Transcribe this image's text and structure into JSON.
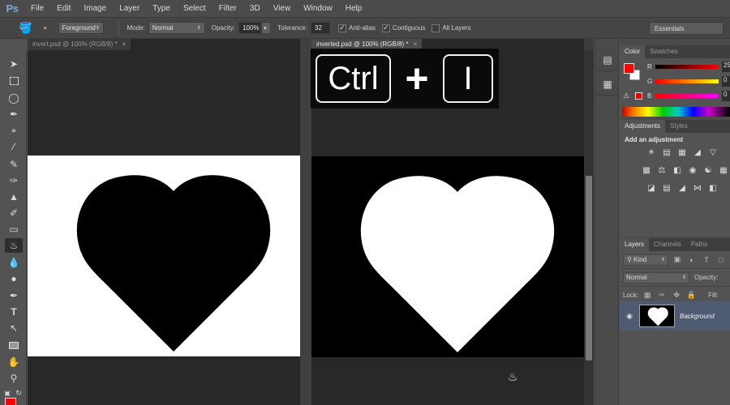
{
  "app": {
    "logo": "Ps",
    "menu": [
      "File",
      "Edit",
      "Image",
      "Layer",
      "Type",
      "Select",
      "Filter",
      "3D",
      "View",
      "Window",
      "Help"
    ]
  },
  "options_bar": {
    "fill_source": "Foreground",
    "mode_label": "Mode:",
    "mode_value": "Normal",
    "opacity_label": "Opacity:",
    "opacity_value": "100%",
    "tolerance_label": "Tolerance:",
    "tolerance_value": "32",
    "anti_alias_label": "Anti-alias",
    "anti_alias_checked": true,
    "contiguous_label": "Contiguous",
    "contiguous_checked": true,
    "all_layers_label": "All Layers",
    "all_layers_checked": false,
    "workspace": "Essentials"
  },
  "toolbox": {
    "tools": [
      "move-tool",
      "marquee-tool",
      "lasso-tool",
      "quick-selection-tool",
      "crop-tool",
      "eyedropper-tool",
      "healing-brush-tool",
      "brush-tool",
      "clone-stamp-tool",
      "history-brush-tool",
      "eraser-tool",
      "paint-bucket-tool",
      "blur-tool",
      "dodge-tool",
      "pen-tool",
      "type-tool",
      "path-selection-tool",
      "rectangle-tool",
      "hand-tool",
      "zoom-tool"
    ],
    "active_tool": "paint-bucket-tool",
    "foreground_color": "#ff0000",
    "background_color": "#ffffff"
  },
  "documents": [
    {
      "tab_label": "invert.psd @ 100% (RGB/8) *",
      "active": false,
      "canvas_bg": "#ffffff",
      "heart_color": "#000000"
    },
    {
      "tab_label": "inverted.psd @ 100% (RGB/8) *",
      "active": true,
      "canvas_bg": "#000000",
      "heart_color": "#ffffff"
    }
  ],
  "shortcut_overlay": {
    "key1": "Ctrl",
    "plus": "+",
    "key2": "I"
  },
  "color_panel": {
    "tabs": [
      "Color",
      "Swatches"
    ],
    "active_tab": "Color",
    "channels": [
      {
        "label": "R",
        "value": "25"
      },
      {
        "label": "G",
        "value": "0"
      },
      {
        "label": "B",
        "value": "0"
      }
    ]
  },
  "adjustments_panel": {
    "tabs": [
      "Adjustments",
      "Styles"
    ],
    "active_tab": "Adjustments",
    "title": "Add an adjustment"
  },
  "layers_panel": {
    "tabs": [
      "Layers",
      "Channels",
      "Paths"
    ],
    "active_tab": "Layers",
    "filter_label": "Kind",
    "blend_mode": "Normal",
    "opacity_label": "Opacity:",
    "lock_label": "Lock:",
    "fill_label": "Fill:",
    "layers": [
      {
        "name": "Background",
        "visible": true,
        "selected": true
      }
    ]
  }
}
